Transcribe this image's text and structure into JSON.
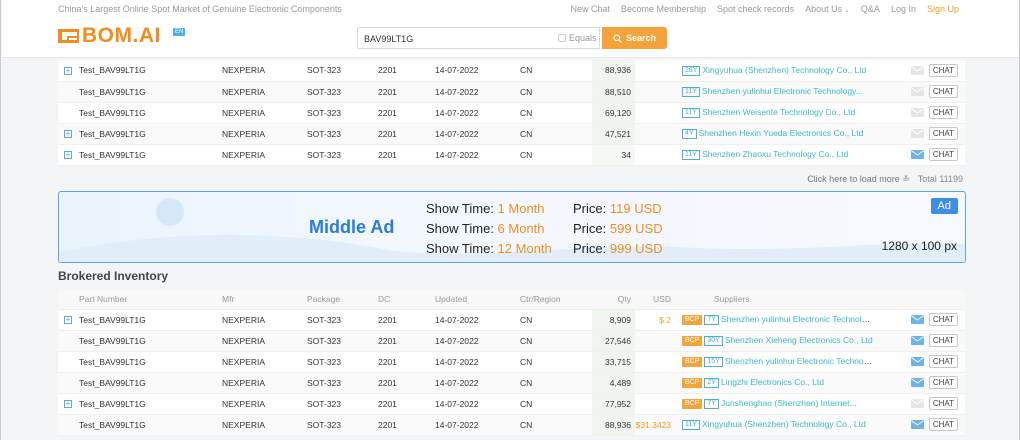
{
  "header": {
    "tagline": "China's Largest Online Spot Market of Genuine Electronic Components",
    "nav": [
      "New Chat",
      "Become Membership",
      "Spot check records",
      "About Us",
      "Q&A",
      "Log In"
    ],
    "signup": "Sign Up",
    "logo_text": "BOM.AI",
    "logo_badge": "EN",
    "search_value": "BAV99LT1G",
    "equals_label": "Equals",
    "search_button": "Search"
  },
  "top_rows": [
    {
      "expand": true,
      "part": "Test_BAV99LT1G",
      "mfr": "NEXPERIA",
      "pkg": "SOT-323",
      "dc": "2201",
      "updated": "14-07-2022",
      "region": "CN",
      "qty": "88,936",
      "usd": "",
      "years": "28Y",
      "supplier": "Xingyuhua (Shenzhen) Technology Co., Ltd",
      "mail_active": false
    },
    {
      "expand": false,
      "part": "Test_BAV99LT1G",
      "mfr": "NEXPERIA",
      "pkg": "SOT-323",
      "dc": "2201",
      "updated": "14-07-2022",
      "region": "CN",
      "qty": "88,510",
      "usd": "",
      "years": "11Y",
      "supplier": "Shenzhen yulinhui Electronic Technology...",
      "mail_active": false
    },
    {
      "expand": false,
      "part": "Test_BAV99LT1G",
      "mfr": "NEXPERIA",
      "pkg": "SOT-323",
      "dc": "2201",
      "updated": "14-07-2022",
      "region": "CN",
      "qty": "69,120",
      "usd": "",
      "years": "11Y",
      "supplier": "Shenzhen Weisente Technology Co., Ltd",
      "mail_active": false
    },
    {
      "expand": true,
      "part": "Test_BAV99LT1G",
      "mfr": "NEXPERIA",
      "pkg": "SOT-323",
      "dc": "2201",
      "updated": "14-07-2022",
      "region": "CN",
      "qty": "47,521",
      "usd": "",
      "years": "4Y",
      "supplier": "Shenzhen Hexin Yueda Electronics Co., Ltd",
      "mail_active": false
    },
    {
      "expand": true,
      "part": "Test_BAV99LT1G",
      "mfr": "NEXPERIA",
      "pkg": "SOT-323",
      "dc": "2201",
      "updated": "14-07-2022",
      "region": "CN",
      "qty": "34",
      "usd": "",
      "years": "11Y",
      "supplier": "Shenzhen Zhaoxu Technology Co., Ltd",
      "mail_active": true
    }
  ],
  "chat_label": "CHAT",
  "load_more": {
    "link": "Click here to load more",
    "total": "Total 11199"
  },
  "ad": {
    "title": "Middle Ad",
    "lines": [
      {
        "show": "Show Time:",
        "dur": "1 Month",
        "price": "Price:",
        "amt": "119 USD"
      },
      {
        "show": "Show Time:",
        "dur": "6 Month",
        "price": "Price:",
        "amt": "599 USD"
      },
      {
        "show": "Show Time:",
        "dur": "12 Month",
        "price": "Price:",
        "amt": "999 USD"
      }
    ],
    "badge": "Ad",
    "size": "1280 x 100 px"
  },
  "brokered": {
    "title": "Brokered Inventory",
    "columns": [
      "Part Number",
      "Mfr",
      "Package",
      "DC",
      "Updated",
      "Ctr/Region",
      "Qty",
      "USD",
      "Suppliers"
    ],
    "rows": [
      {
        "expand": true,
        "part": "Test_BAV99LT1G",
        "mfr": "NEXPERIA",
        "pkg": "SOT-323",
        "dc": "2201",
        "updated": "14-07-2022",
        "region": "CN",
        "qty": "8,909",
        "usd": "$ 2",
        "bcp": true,
        "years": "7Y",
        "supplier": "Shenzhen yulinhui Electronic Technology...",
        "mail_active": true
      },
      {
        "expand": false,
        "part": "Test_BAV99LT1G",
        "mfr": "NEXPERIA",
        "pkg": "SOT-323",
        "dc": "2201",
        "updated": "14-07-2022",
        "region": "CN",
        "qty": "27,546",
        "usd": "",
        "bcp": true,
        "years": "30Y",
        "supplier": "Shenzhen Xieheng Electronics Co., Ltd",
        "mail_active": true
      },
      {
        "expand": false,
        "part": "Test_BAV99LT1G",
        "mfr": "NEXPERIA",
        "pkg": "SOT-323",
        "dc": "2201",
        "updated": "14-07-2022",
        "region": "CN",
        "qty": "33,715",
        "usd": "",
        "bcp": true,
        "years": "15Y",
        "supplier": "Shenzhen yulinhui Electronic Technology...",
        "mail_active": true
      },
      {
        "expand": false,
        "part": "Test_BAV99LT1G",
        "mfr": "NEXPERIA",
        "pkg": "SOT-323",
        "dc": "2201",
        "updated": "14-07-2022",
        "region": "CN",
        "qty": "4,489",
        "usd": "",
        "bcp": true,
        "years": "2Y",
        "supplier": "Lingzhi Electronics Co., Ltd",
        "mail_active": true
      },
      {
        "expand": true,
        "part": "Test_BAV99LT1G",
        "mfr": "NEXPERIA",
        "pkg": "SOT-323",
        "dc": "2201",
        "updated": "14-07-2022",
        "region": "CN",
        "qty": "77,952",
        "usd": "",
        "bcp": true,
        "years": "7Y",
        "supplier": "Junshenghao (Shenzhen) Internet...",
        "mail_active": false
      },
      {
        "expand": false,
        "part": "Test_BAV99LT1G",
        "mfr": "NEXPERIA",
        "pkg": "SOT-323",
        "dc": "2201",
        "updated": "14-07-2022",
        "region": "CN",
        "qty": "88,936",
        "usd": "$31.3423",
        "bcp": false,
        "years": "11Y",
        "supplier": "Xingyuhua (Shenzhen) Technology Co., Ltd",
        "mail_active": true
      }
    ]
  },
  "colors": {
    "accent": "#f5a23a",
    "brand": "#f08d1e",
    "link": "#3bb8c3",
    "ad_border": "#5aa7e6"
  }
}
